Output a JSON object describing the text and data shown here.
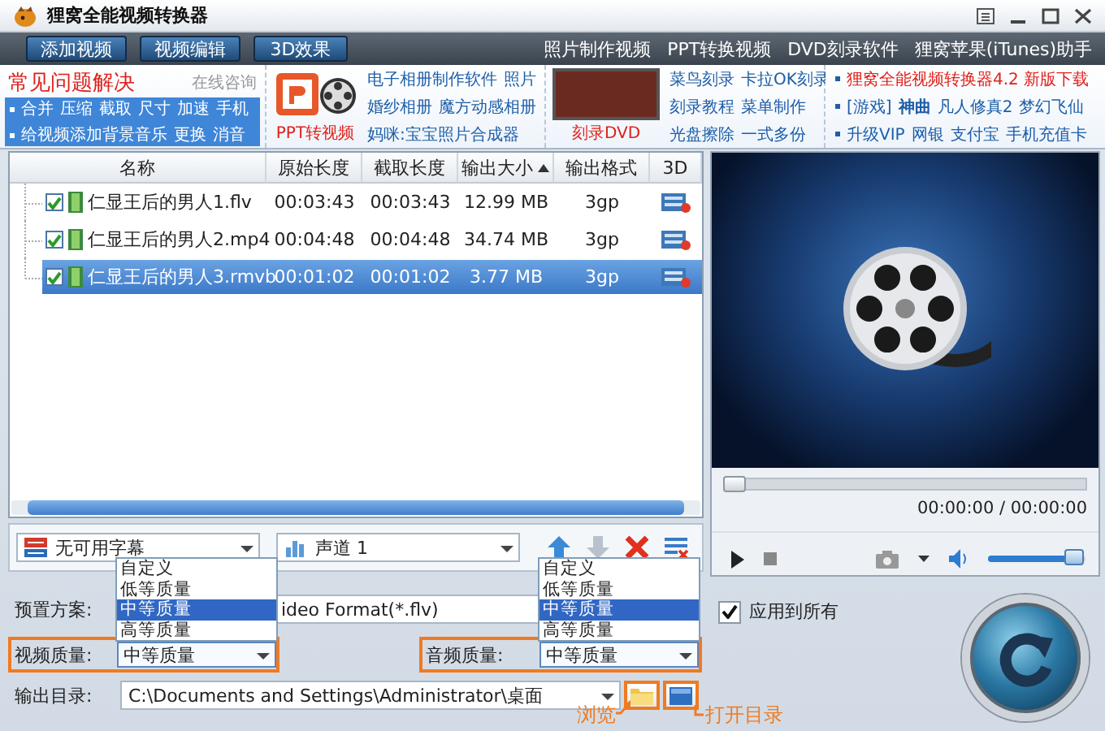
{
  "window": {
    "title": "狸窝全能视频转换器"
  },
  "toolbar": {
    "buttons": [
      "添加视频",
      "视频编辑",
      "3D效果"
    ],
    "links": [
      "照片制作视频",
      "PPT转换视频",
      "DVD刻录软件",
      "狸窝苹果(iTunes)助手"
    ]
  },
  "promo": {
    "faq_title": "常见问题解决",
    "consult": "在线咨询",
    "faq_links": [
      [
        "合并",
        "压缩",
        "截取",
        "尺寸",
        "加速",
        "手机"
      ],
      [
        "给视频添加背景音乐",
        "更换",
        "消音"
      ]
    ],
    "ppt_caption": "PPT转视频",
    "ppt_links": [
      [
        "电子相册制作软件",
        "照片"
      ],
      [
        "婚纱相册",
        "魔方动感相册"
      ],
      [
        "妈咪:宝宝照片合成器"
      ]
    ],
    "dvd_caption": "刻录DVD",
    "dvd_links": [
      [
        "菜鸟刻录",
        "卡拉OK刻录"
      ],
      [
        "刻录教程",
        "菜单制作"
      ],
      [
        "光盘擦除",
        "一式多份"
      ]
    ],
    "news": [
      [
        {
          "text": "狸窝全能视频转换器4.2 新版下载",
          "kind": "hot"
        }
      ],
      [
        {
          "text": "[游戏]",
          "kind": "plain"
        },
        {
          "text": "神曲",
          "kind": "bold"
        },
        {
          "text": "凡人修真2",
          "kind": "plain"
        },
        {
          "text": "梦幻飞仙",
          "kind": "plain"
        }
      ],
      [
        {
          "text": "升级VIP",
          "kind": "plain"
        },
        {
          "text": "网银",
          "kind": "plain"
        },
        {
          "text": "支付宝",
          "kind": "plain"
        },
        {
          "text": "手机充值卡",
          "kind": "plain"
        }
      ]
    ]
  },
  "table": {
    "columns": [
      {
        "label": "名称",
        "sorted": false
      },
      {
        "label": "原始长度",
        "sorted": false
      },
      {
        "label": "截取长度",
        "sorted": false
      },
      {
        "label": "输出大小",
        "sorted": true
      },
      {
        "label": "输出格式",
        "sorted": false
      },
      {
        "label": "3D",
        "sorted": false
      }
    ],
    "rows": [
      {
        "name": "仁显王后的男人1.flv",
        "original": "00:03:43",
        "trimmed": "00:03:43",
        "size": "12.99 MB",
        "format": "3gp",
        "checked": true,
        "selected": false
      },
      {
        "name": "仁显王后的男人2.mp4",
        "original": "00:04:48",
        "trimmed": "00:04:48",
        "size": "34.74 MB",
        "format": "3gp",
        "checked": true,
        "selected": false
      },
      {
        "name": "仁显王后的男人3.rmvb",
        "original": "00:01:02",
        "trimmed": "00:01:02",
        "size": "3.77 MB",
        "format": "3gp",
        "checked": true,
        "selected": true
      }
    ]
  },
  "tracks": {
    "subtitle": "无可用字幕",
    "audio": "声道 1",
    "tools": [
      {
        "kind": "up",
        "disabled": false
      },
      {
        "kind": "down",
        "disabled": true
      },
      {
        "kind": "delete",
        "disabled": false
      },
      {
        "kind": "clear",
        "disabled": false
      }
    ]
  },
  "player": {
    "seek": {
      "level": 0
    },
    "time": "00:00:00 / 00:00:00",
    "volume": {
      "level": 0.95
    }
  },
  "settings": {
    "preset": {
      "label": "预置方案:",
      "value": "ideo Format(*.flv)"
    },
    "video_quality": {
      "label": "视频质量:",
      "value": "中等质量",
      "expanded": true,
      "highlighted": true,
      "options": [
        {
          "label": "自定义",
          "selected": false
        },
        {
          "label": "低等质量",
          "selected": false
        },
        {
          "label": "中等质量",
          "selected": true
        },
        {
          "label": "高等质量",
          "selected": false
        }
      ]
    },
    "audio_quality": {
      "label": "音频质量:",
      "value": "中等质量",
      "expanded": true,
      "highlighted": true,
      "options": [
        {
          "label": "自定义",
          "selected": false
        },
        {
          "label": "低等质量",
          "selected": false
        },
        {
          "label": "中等质量",
          "selected": true
        },
        {
          "label": "高等质量",
          "selected": false
        }
      ]
    },
    "output": {
      "label": "输出目录:",
      "value": "C:\\Documents and Settings\\Administrator\\桌面"
    },
    "apply_all": {
      "label": "应用到所有",
      "checked": true
    },
    "annotations": {
      "browse": "浏览",
      "open_folder": "打开目录"
    }
  }
}
